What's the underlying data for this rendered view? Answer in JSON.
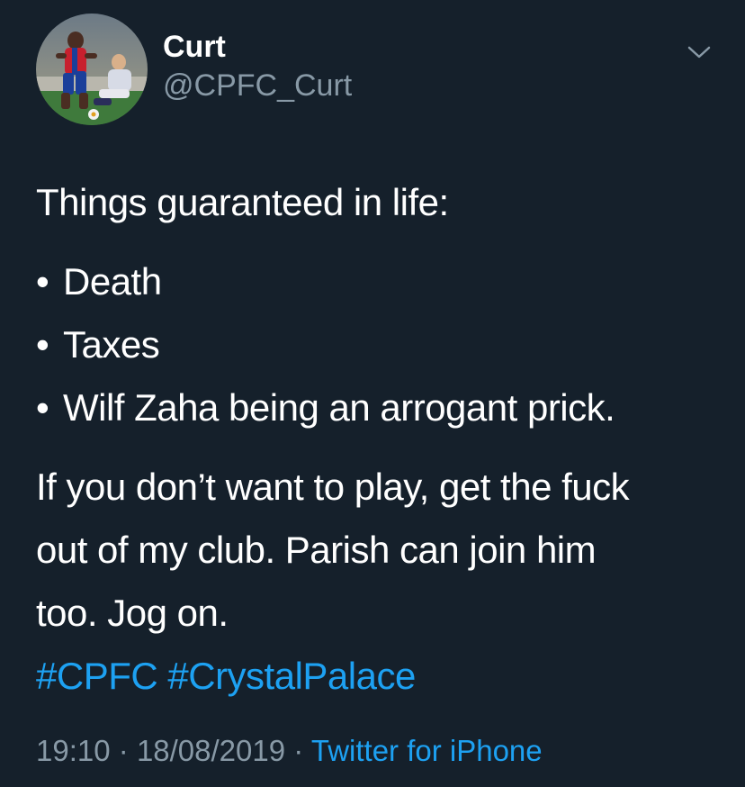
{
  "user": {
    "display_name": "Curt",
    "handle": "@CPFC_Curt"
  },
  "icons": {
    "menu": "chevron-down-icon",
    "avatar": "profile-photo"
  },
  "tweet": {
    "intro": "Things guaranteed in life:",
    "bullet_symbol": "•",
    "bullets": [
      "Death",
      "Taxes",
      "Wilf Zaha being an arrogant prick."
    ],
    "paragraph_lines": [
      "If you don’t want to play, get the fuck",
      "out of my club. Parish can join him",
      "too. Jog on."
    ],
    "hashtags": [
      "#CPFC",
      "#CrystalPalace"
    ]
  },
  "meta": {
    "time": "19:10",
    "separator": "·",
    "date": "18/08/2019",
    "source": "Twitter for iPhone"
  },
  "colors": {
    "background": "#15202b",
    "text": "#ffffff",
    "secondary": "#8899a6",
    "link": "#1da1f2"
  }
}
